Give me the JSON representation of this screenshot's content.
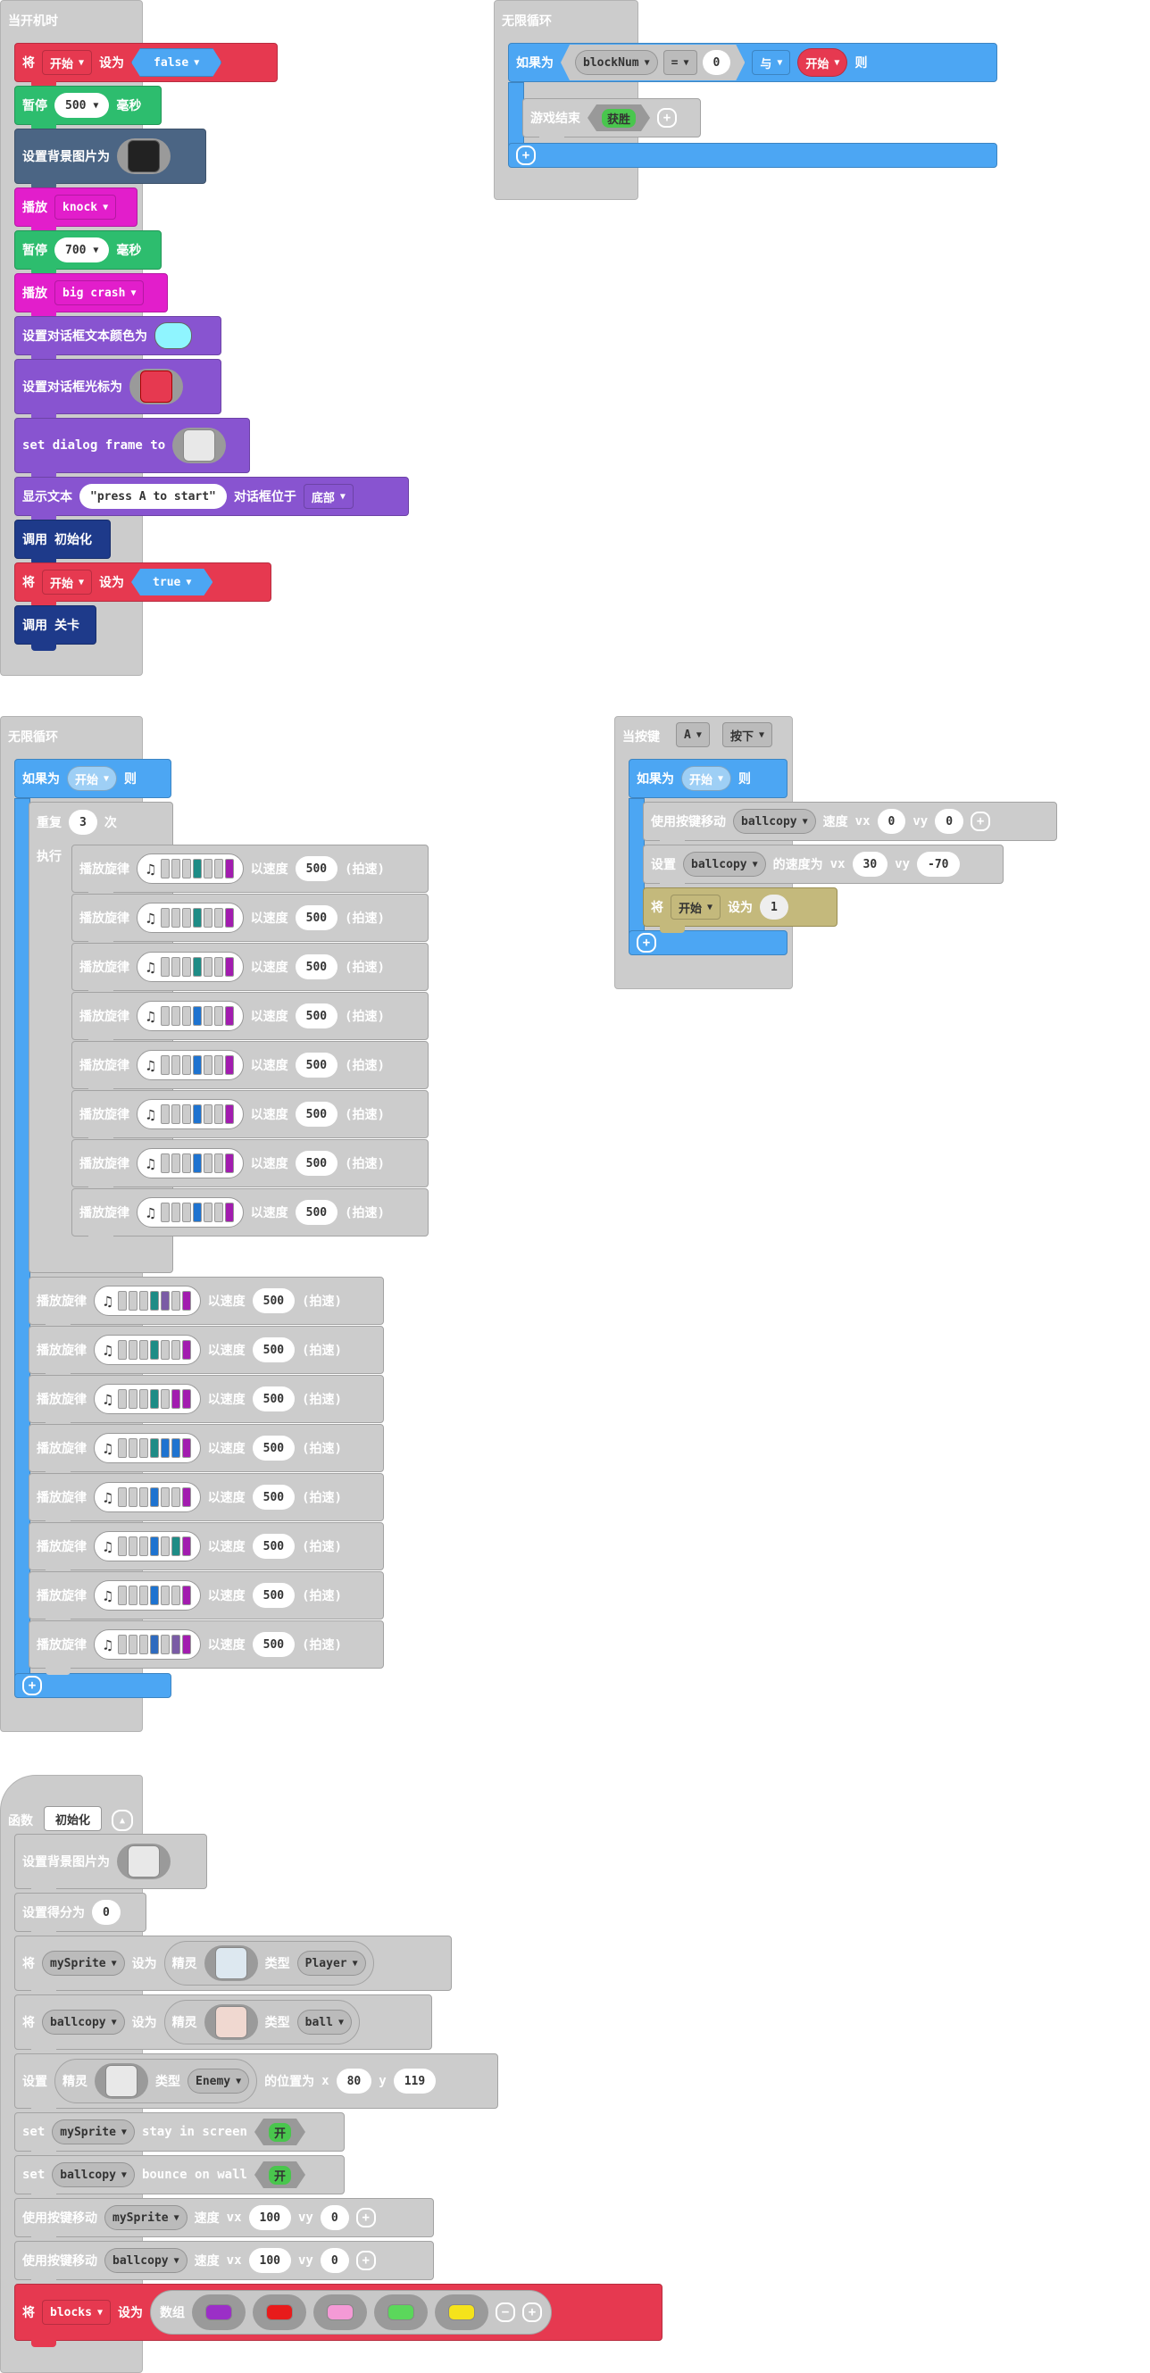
{
  "colors": {
    "logic_red": "#e63950",
    "pause_green": "#2dbd6e",
    "scene_slate": "#4b6584",
    "music_magenta": "#e21ecb",
    "game_purple": "#8854d0",
    "func_navy": "#1e3a8a",
    "ctrl_blue": "#4ca6f3",
    "gray": "#cccccc",
    "olive": "#c4b97c"
  },
  "common": {
    "set": "将",
    "to": "设为",
    "true": "true",
    "false": "false",
    "start_var": "开始",
    "pause": "暂停",
    "ms": "毫秒",
    "play": "播放",
    "if": "如果为",
    "then": "则",
    "repeat": "重复",
    "times": "次",
    "execute": "执行",
    "play_melody": "播放旋律",
    "at_tempo": "以速度",
    "bpm": "(拍速)",
    "tempo": "500",
    "plus": "+",
    "minus": "−"
  },
  "on_start": {
    "hat": "当开机时",
    "pause1": "500",
    "pause2": "700",
    "set_bg": "设置背景图片为",
    "sound1": "knock",
    "sound2": "big crash",
    "dialog_text_color": "设置对话框文本颜色为",
    "dialog_cursor": "设置对话框光标为",
    "dialog_frame": "set dialog frame to",
    "show_text": "显示文本",
    "show_text_value": "\"press A to start\"",
    "dialog_pos": "对话框位于",
    "dialog_pos_value": "底部",
    "call": "调用",
    "call_init": "初始化",
    "call_level": "关卡"
  },
  "forever1": {
    "hat": "无限循环",
    "var": "blockNum",
    "op": "=",
    "num": "0",
    "and": "与",
    "start": "开始",
    "game_over": "游戏结束",
    "win": "获胜"
  },
  "forever2": {
    "hat": "无限循环",
    "repeat_count": "3"
  },
  "on_button": {
    "hat": "当按键",
    "key": "A",
    "action": "按下",
    "move_with_buttons": "使用按键移动",
    "sprite": "ballcopy",
    "speed": "速度",
    "vx": "vx",
    "vy": "vy",
    "vx1": "0",
    "vy1": "0",
    "set": "设置",
    "velocity_to": "的速度为",
    "vx2": "30",
    "vy2": "-70",
    "set_value": "1"
  },
  "func": {
    "label": "函数",
    "name": "初始化",
    "set_bg": "设置背景图片为",
    "set_score": "设置得分为",
    "score": "0",
    "sprite_label": "精灵",
    "kind_label": "类型",
    "var1": "mySprite",
    "kind1": "Player",
    "var2": "ballcopy",
    "kind2": "ball",
    "set": "设置",
    "kind3": "Enemy",
    "pos_to": "的位置为",
    "x": "x",
    "y": "y",
    "x_val": "80",
    "y_val": "119",
    "set_en": "set",
    "stay_in_screen": "stay in screen",
    "bounce_on_wall": "bounce on wall",
    "on": "开",
    "move_with_buttons": "使用按键移动",
    "speed": "速度",
    "vx": "vx",
    "vy": "vy",
    "vx_val": "100",
    "vy_val": "0",
    "blocks_var": "blocks",
    "array": "数组"
  }
}
